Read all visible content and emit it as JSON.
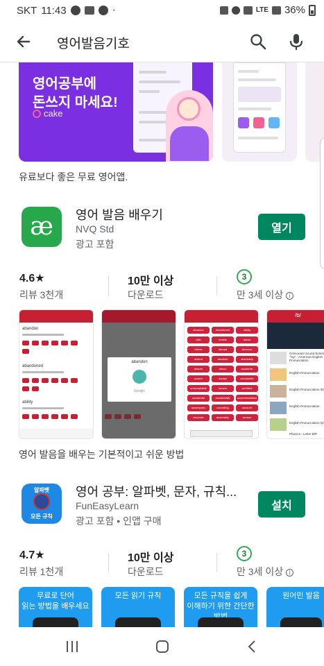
{
  "status_bar": {
    "carrier": "SKT",
    "time": "11:43",
    "network": "LTE",
    "battery": "36%"
  },
  "search": {
    "query": "영어발음기호"
  },
  "promo": {
    "banner_headline_line1": "영어공부에",
    "banner_headline_line2": "돈쓰지 마세요!",
    "banner_brand": "cake",
    "caption": "유료보다 좋은 무료 영어앱."
  },
  "apps": [
    {
      "title": "영어 발음 배우기",
      "developer": "NVQ Std",
      "ads_note": "광고 포함",
      "action_label": "열기",
      "rating": "4.6★",
      "reviews": "리뷰 3천개",
      "downloads": "10만 이상",
      "downloads_label": "다운로드",
      "age_badge": "3",
      "age_label": "만 3세 이상",
      "description": "영어 발음을 배우는 기본적이고 쉬운 방법"
    },
    {
      "title": "영어 공부: 알파벳, 문자, 규칙...",
      "developer": "FunEasyLearn",
      "ads_note": "광고 포함 • 인앱 구매",
      "action_label": "설치",
      "rating": "4.7★",
      "reviews": "리뷰 1천개",
      "downloads": "10만 이상",
      "downloads_label": "다운로드",
      "age_badge": "3",
      "age_label": "만 3세 이상",
      "icon_top_text": "알파벳",
      "icon_bottom_text": "모든 규칙"
    }
  ],
  "screens_app2": [
    {
      "caption": "무료로 단어\n읽는 방법을 배우세요"
    },
    {
      "caption": "모든 읽기 규칙"
    },
    {
      "caption": "모든 규칙을 쉽게\n이해하기 위한 간단한 방법"
    },
    {
      "caption": "원어민 발음"
    }
  ],
  "screens_app1": {
    "word_list": [
      "abandon",
      "abandoned",
      "ability"
    ],
    "dialog_word": "abandon",
    "dialog_footer": "Google",
    "chips": [
      "abandon",
      "abandoned",
      "ability",
      "able",
      "unable",
      "about",
      "above",
      "abroad",
      "absence",
      "absent",
      "absolute",
      "absolutely",
      "absorb",
      "abuse",
      "academic",
      "accent",
      "accept",
      "acceptable",
      "unacceptable",
      "access",
      "accident",
      "accidental",
      "accidentally",
      "accommodation",
      "accompany",
      "according",
      "account",
      "accurate",
      "accurately",
      "accuse",
      "achieve",
      "achievement",
      "acid",
      "acknowledge",
      "across",
      "acquire",
      "act",
      "action"
    ],
    "video_titles": [
      "Consonant Sound Series \"ing\" - American English Pronunciation",
      "English Pronunciation",
      "English Pronunciation /b/",
      "English Pronunciation",
      "English Pronunciation /p/",
      "Phonics - Letter B/P"
    ],
    "video_header": "/b/"
  },
  "nav": {
    "recents": "recents",
    "home": "home",
    "back": "back"
  }
}
